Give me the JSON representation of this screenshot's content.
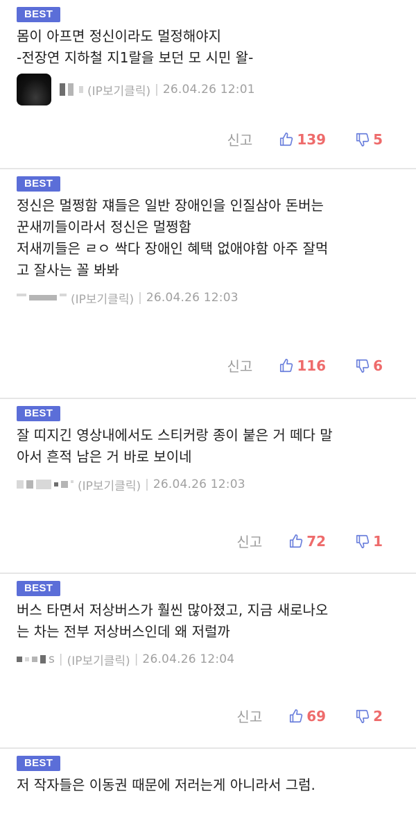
{
  "labels": {
    "best_badge": "BEST",
    "ip_label": "(IP보기클릭)",
    "separator": "|",
    "report": "신고"
  },
  "colors": {
    "badge_bg": "#5b6ed8",
    "vote_icon": "#6a7fdc",
    "vote_count": "#ee6b6b",
    "meta_text": "#a0a0a0"
  },
  "icons": {
    "like": "thumbs-up-icon",
    "dislike": "thumbs-down-icon"
  },
  "comments": [
    {
      "lines": [
        "몸이 아프면 정신이라도 멀정해야지",
        "-전장연 지하철 지1랄을 보던 모 시민 왈-"
      ],
      "date": "26.04.26 12:01",
      "likes": "139",
      "dislikes": "5",
      "has_avatar": true
    },
    {
      "lines": [
        "정신은 멀쩡함 쟤들은 일반 장애인을 인질삼아 돈버는",
        "꾼새끼들이라서 정신은 멀쩡함",
        "저새끼들은 ㄹㅇ 싹다 장애인 혜택 없애야함 아주 잘먹",
        "고 잘사는 꼴 봐봐"
      ],
      "date": "26.04.26 12:03",
      "likes": "116",
      "dislikes": "6",
      "has_avatar": false
    },
    {
      "lines": [
        "잘 띠지긴 영상내에서도 스티커랑 종이 붙은 거 떼다 말",
        "아서 흔적 남은 거 바로 보이네"
      ],
      "date": "26.04.26 12:03",
      "likes": "72",
      "dislikes": "1",
      "has_avatar": false
    },
    {
      "lines": [
        "버스 타면서 저상버스가 훨씬 많아졌고, 지금 새로나오",
        "는 차는 전부 저상버스인데 왜 저럴까"
      ],
      "nick_suffix": "s",
      "date": "26.04.26 12:04",
      "likes": "69",
      "dislikes": "2",
      "has_avatar": false
    },
    {
      "lines": [
        "저 작자들은 이동권 때문에 저러는게 아니라서 그럼."
      ]
    }
  ]
}
